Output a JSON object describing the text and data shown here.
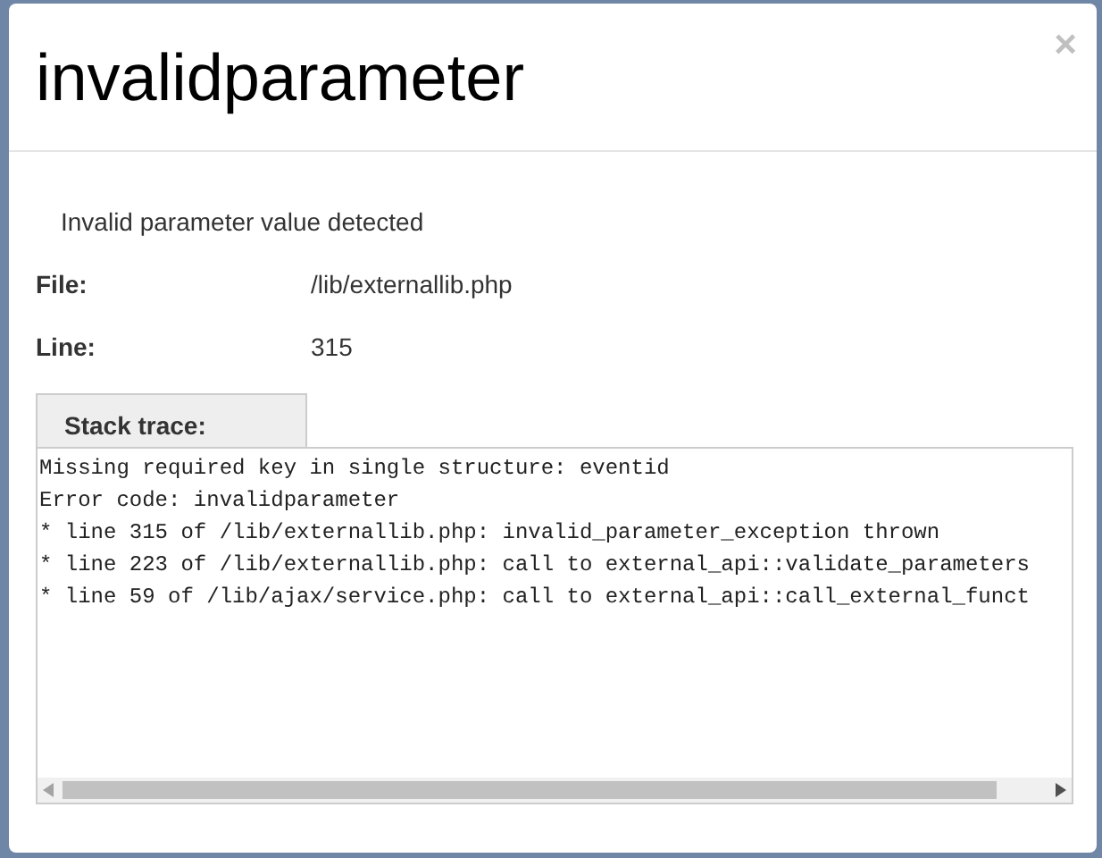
{
  "dialog": {
    "title": "invalidparameter",
    "close": "×"
  },
  "message": "Invalid parameter value detected",
  "fields": [
    {
      "label": "File:",
      "value": "/lib/externallib.php"
    },
    {
      "label": "Line:",
      "value": "315"
    }
  ],
  "stack_trace": {
    "heading": "Stack trace:",
    "lines": [
      "Missing required key in single structure: eventid",
      "Error code: invalidparameter",
      "* line 315 of /lib/externallib.php: invalid_parameter_exception thrown",
      "* line 223 of /lib/externallib.php: call to external_api::validate_parameters",
      "* line 59 of /lib/ajax/service.php: call to external_api::call_external_funct"
    ]
  }
}
